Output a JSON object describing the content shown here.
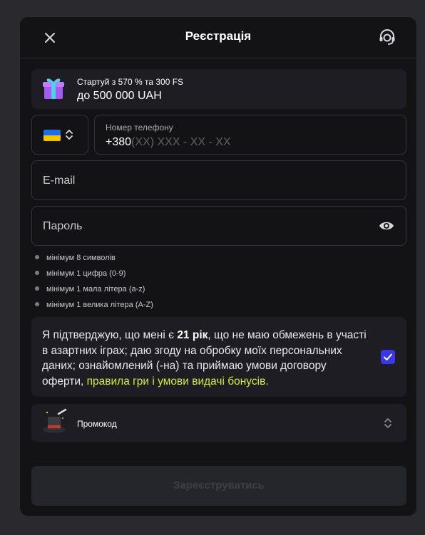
{
  "header": {
    "title": "Реєстрація"
  },
  "bonus": {
    "line1": "Стартуй з 570 % та 300 FS",
    "line2": "до 500 000 UAH"
  },
  "phone": {
    "label": "Номер телефону",
    "prefix": "+380",
    "placeholder": "(XX) XXX - XX - XX",
    "country_flag": "ukraine-flag"
  },
  "email": {
    "placeholder": "E-mail"
  },
  "password": {
    "placeholder": "Пароль"
  },
  "password_rules": [
    "мінімум 8 символів",
    "мінімум 1 цифра (0-9)",
    "мінімум 1 мала літера (a-z)",
    "мінімум 1 велика літера (A-Z)"
  ],
  "consent": {
    "part1": "Я підтверджую, що мені є ",
    "age": "21 рік",
    "part2": ", що не маю обмежень в участі в азартних іграх; даю згоду на обробку моїх персональних даних; ознайомлений (-на) та приймаю умови договору оферти, ",
    "link_rules": "правила гри",
    "joiner": " і ",
    "link_bonus": "умови видачі бонусів",
    "end": ".",
    "checked": true
  },
  "promo": {
    "label": "Промокод"
  },
  "submit": {
    "label": "Зареєструватись"
  },
  "colors": {
    "accent": "#3a37e6",
    "highlight": "#d4ec2b",
    "modal_bg": "#131316",
    "card_bg": "#1d1d23"
  }
}
